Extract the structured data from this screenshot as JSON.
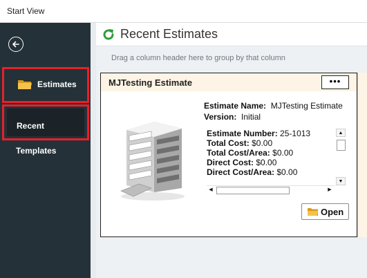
{
  "window": {
    "title": "Start View"
  },
  "sidebar": {
    "items": [
      {
        "label": "Estimates",
        "icon": "folder-icon"
      },
      {
        "label": "Recent"
      },
      {
        "label": "Templates"
      }
    ]
  },
  "main": {
    "title": "Recent Estimates",
    "group_hint": "Drag a column header here to group by that column"
  },
  "card": {
    "title": "MJTesting Estimate",
    "more_label": "•••",
    "estimate_name_label": "Estimate Name:",
    "estimate_name_value": "MJTesting Estimate",
    "version_label": "Version:",
    "version_value": "Initial",
    "details": [
      {
        "label": "Estimate Number:",
        "value": "25-1013"
      },
      {
        "label": "Total Cost:",
        "value": "$0.00"
      },
      {
        "label": "Total Cost/Area:",
        "value": "$0.00"
      },
      {
        "label": "Direct Cost:",
        "value": "$0.00"
      },
      {
        "label": "Direct Cost/Area:",
        "value": "$0.00"
      }
    ],
    "open_label": "Open"
  },
  "colors": {
    "sidebar_bg": "#243138",
    "highlight": "#e8202a",
    "card_header_bg": "#fdf4e5",
    "refresh_icon": "#2e9d3a",
    "folder": "#f2b632"
  }
}
